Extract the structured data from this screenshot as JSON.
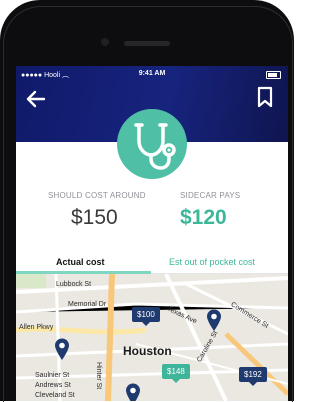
{
  "status_bar": {
    "carrier": "Hooli",
    "time": "9:41 AM"
  },
  "header": {
    "back_icon": "arrow-left-icon",
    "bookmark_icon": "bookmark-icon",
    "category_icon": "stethoscope-icon"
  },
  "costs": {
    "should_cost_label": "SHOULD COST AROUND",
    "should_cost_value": "$150",
    "sidecar_label": "SIDECAR PAYS",
    "sidecar_value": "$120"
  },
  "tabs": [
    {
      "label": "Actual cost"
    },
    {
      "label": "Est out of pocket cost"
    }
  ],
  "map": {
    "city": "Houston",
    "streets": [
      "Lubbock St",
      "Memorial Dr",
      "Allen Pkwy",
      "Texas Ave",
      "Commerce St",
      "Saulnier St",
      "Andrews St",
      "Cleveland St",
      "Hinter St",
      "Caroline St"
    ],
    "prices": [
      "$100",
      "$148",
      "$192"
    ]
  },
  "colors": {
    "header": "#17247e",
    "accent": "#4fc0a6",
    "price_dark": "#1f3a6e",
    "price_teal": "#3eb49a"
  }
}
